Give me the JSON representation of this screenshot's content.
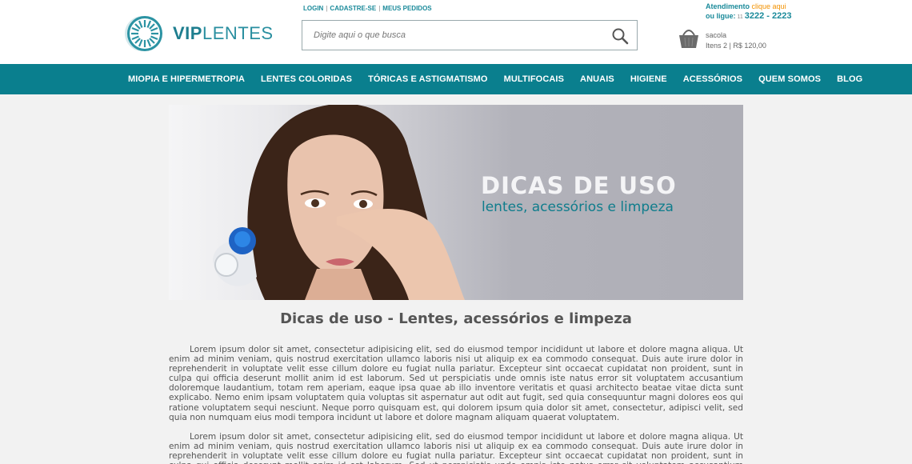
{
  "header": {
    "logo": {
      "bold": "VIP",
      "light": "LENTES"
    },
    "top_links": [
      "LOGIN",
      "CADASTRE-SE",
      "MEUS PEDIDOS"
    ],
    "search": {
      "placeholder": "Digite aqui o que busca"
    },
    "cart": {
      "label": "sacola",
      "info": "Itens 2 | R$ 120,00"
    },
    "support": {
      "label": "Atendimento",
      "link": "clique aqui",
      "or_call": "ou ligue:",
      "area_code": "11",
      "phone": "3222 - 2223"
    }
  },
  "nav": {
    "items": [
      "MIOPIA E HIPERMETROPIA",
      "LENTES COLORIDAS",
      "TÓRICAS E ASTIGMATISMO",
      "MULTIFOCAIS",
      "ANUAIS",
      "HIGIENE",
      "ACESSÓRIOS",
      "QUEM SOMOS",
      "BLOG"
    ]
  },
  "banner": {
    "title": "DICAS DE USO",
    "subtitle": "lentes, acessórios e limpeza"
  },
  "content": {
    "title": "Dicas de uso - Lentes, acessórios e limpeza",
    "paragraphs": [
      "Lorem ipsum dolor sit amet, consectetur adipisicing elit, sed do eiusmod tempor incididunt ut labore et dolore magna aliqua. Ut enim ad minim veniam, quis nostrud exercitation ullamco laboris nisi ut aliquip ex ea commodo consequat. Duis aute irure dolor in reprehenderit in voluptate velit esse cillum dolore eu fugiat nulla pariatur. Excepteur sint occaecat cupidatat non proident, sunt in culpa qui officia deserunt mollit anim id est laborum. Sed ut perspiciatis unde omnis iste natus error sit voluptatem accusantium doloremque laudantium, totam rem aperiam, eaque ipsa quae ab illo inventore veritatis et quasi architecto beatae vitae dicta sunt explicabo. Nemo enim ipsam voluptatem quia voluptas sit aspernatur aut odit aut fugit, sed quia consequuntur magni dolores eos qui ratione voluptatem sequi nesciunt. Neque porro quisquam est, qui dolorem ipsum quia dolor sit amet, consectetur, adipisci velit, sed quia non numquam eius modi tempora incidunt ut labore et dolore magnam aliquam quaerat voluptatem.",
      "Lorem ipsum dolor sit amet, consectetur adipisicing elit, sed do eiusmod tempor incididunt ut labore et dolore magna aliqua. Ut enim ad minim veniam, quis nostrud exercitation ullamco laboris nisi ut aliquip ex ea commodo consequat. Duis aute irure dolor in reprehenderit in voluptate velit esse cillum dolore eu fugiat nulla pariatur. Excepteur sint occaecat cupidatat non proident, sunt in culpa qui officia deserunt mollit anim id est laborum. Sed ut perspiciatis unde omnis iste natus error sit voluptatem accusantium doloremque laudantium."
    ]
  },
  "colors": {
    "brand_teal": "#0a7f8e",
    "accent_orange": "#f39200",
    "page_bg": "#f2f2f2"
  },
  "icons": [
    "logo-iris-icon",
    "search-icon",
    "shopping-bag-icon"
  ]
}
